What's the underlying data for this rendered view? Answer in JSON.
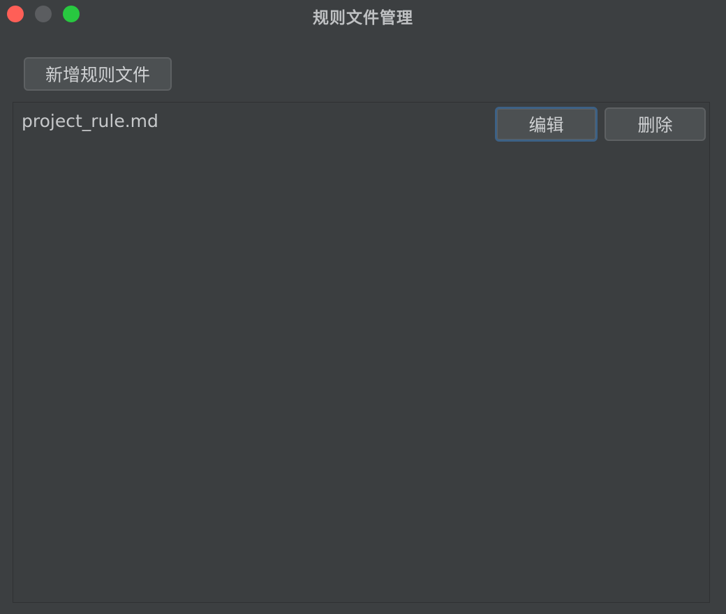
{
  "window": {
    "title": "规则文件管理"
  },
  "toolbar": {
    "add_label": "新增规则文件"
  },
  "files": [
    {
      "name": "project_rule.md",
      "edit_label": "编辑",
      "delete_label": "删除"
    }
  ],
  "colors": {
    "background": "#3c3f41",
    "button": "#4c5052",
    "focus_ring": "#3d6185",
    "close": "#ff5f57",
    "minimize": "#5b5d60",
    "zoom": "#28c840"
  }
}
